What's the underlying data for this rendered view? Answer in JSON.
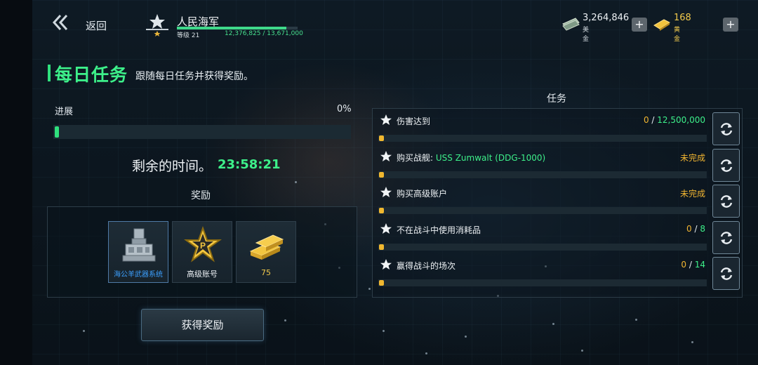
{
  "topbar": {
    "back_label": "返回",
    "player_name": "人民海军",
    "level": "等级 21",
    "xp": "12,376,825 / 13,671,000",
    "xp_fraction": 0.905,
    "money_value": "3,264,846",
    "money_label": "美金",
    "gold_value": "168",
    "gold_label": "黄金",
    "plus": "+"
  },
  "header": {
    "title": "每日任务",
    "subtitle": "跟随每日任务并获得奖励。"
  },
  "progress": {
    "label": "进展",
    "percent": "0%",
    "value": 0
  },
  "timer": {
    "label": "剩余的时间。",
    "value": "23:58:21"
  },
  "rewards": {
    "title": "奖励",
    "items": [
      {
        "label": "海公羊武器系统",
        "icon": "weapon-turret-icon"
      },
      {
        "label": "高级账号",
        "icon": "premium-star-icon"
      },
      {
        "label": "75",
        "icon": "gold-bars-icon"
      }
    ],
    "claim_label": "获得奖励"
  },
  "missions": {
    "title": "任务",
    "items": [
      {
        "name": "伤害达到",
        "ship": "",
        "current": "0",
        "sep": " / ",
        "total": "12,500,000",
        "status": ""
      },
      {
        "name": "购买战舰: ",
        "ship": "USS Zumwalt (DDG-1000)",
        "current": "",
        "sep": "",
        "total": "",
        "status": "未完成"
      },
      {
        "name": "购买高级账户",
        "ship": "",
        "current": "",
        "sep": "",
        "total": "",
        "status": "未完成"
      },
      {
        "name": "不在战斗中使用消耗品",
        "ship": "",
        "current": "0",
        "sep": " / ",
        "total": "8",
        "status": ""
      },
      {
        "name": "赢得战斗的场次",
        "ship": "",
        "current": "0",
        "sep": " / ",
        "total": "14",
        "status": ""
      }
    ]
  },
  "colors": {
    "accent_green": "#3df08a",
    "gold": "#f1b531",
    "reward_blue": "#3ca0ff"
  }
}
